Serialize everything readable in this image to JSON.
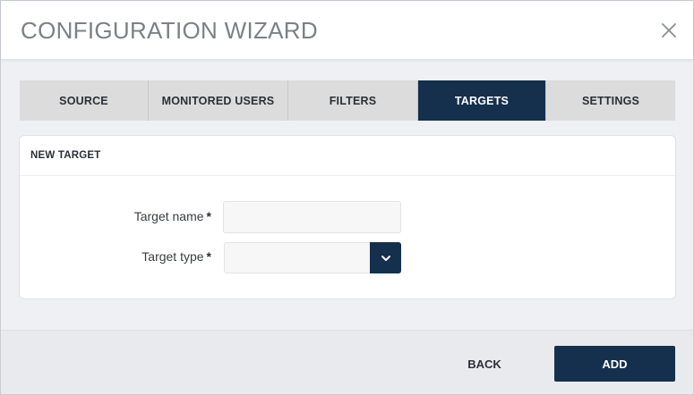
{
  "dialog": {
    "title": "CONFIGURATION WIZARD",
    "close_icon": "close-icon"
  },
  "tabs": [
    {
      "label": "SOURCE",
      "active": false
    },
    {
      "label": "MONITORED USERS",
      "active": false
    },
    {
      "label": "FILTERS",
      "active": false
    },
    {
      "label": "TARGETS",
      "active": true
    },
    {
      "label": "SETTINGS",
      "active": false
    }
  ],
  "panel": {
    "title": "NEW TARGET",
    "fields": {
      "target_name": {
        "label": "Target name",
        "required_mark": "*",
        "value": "",
        "placeholder": ""
      },
      "target_type": {
        "label": "Target type",
        "required_mark": "*",
        "selected": "",
        "dropdown_icon": "chevron-down-icon"
      }
    }
  },
  "footer": {
    "back_label": "BACK",
    "add_label": "ADD"
  },
  "colors": {
    "accent": "#14304d",
    "tab_inactive": "#dcdcdd",
    "background": "#eff0f3"
  }
}
